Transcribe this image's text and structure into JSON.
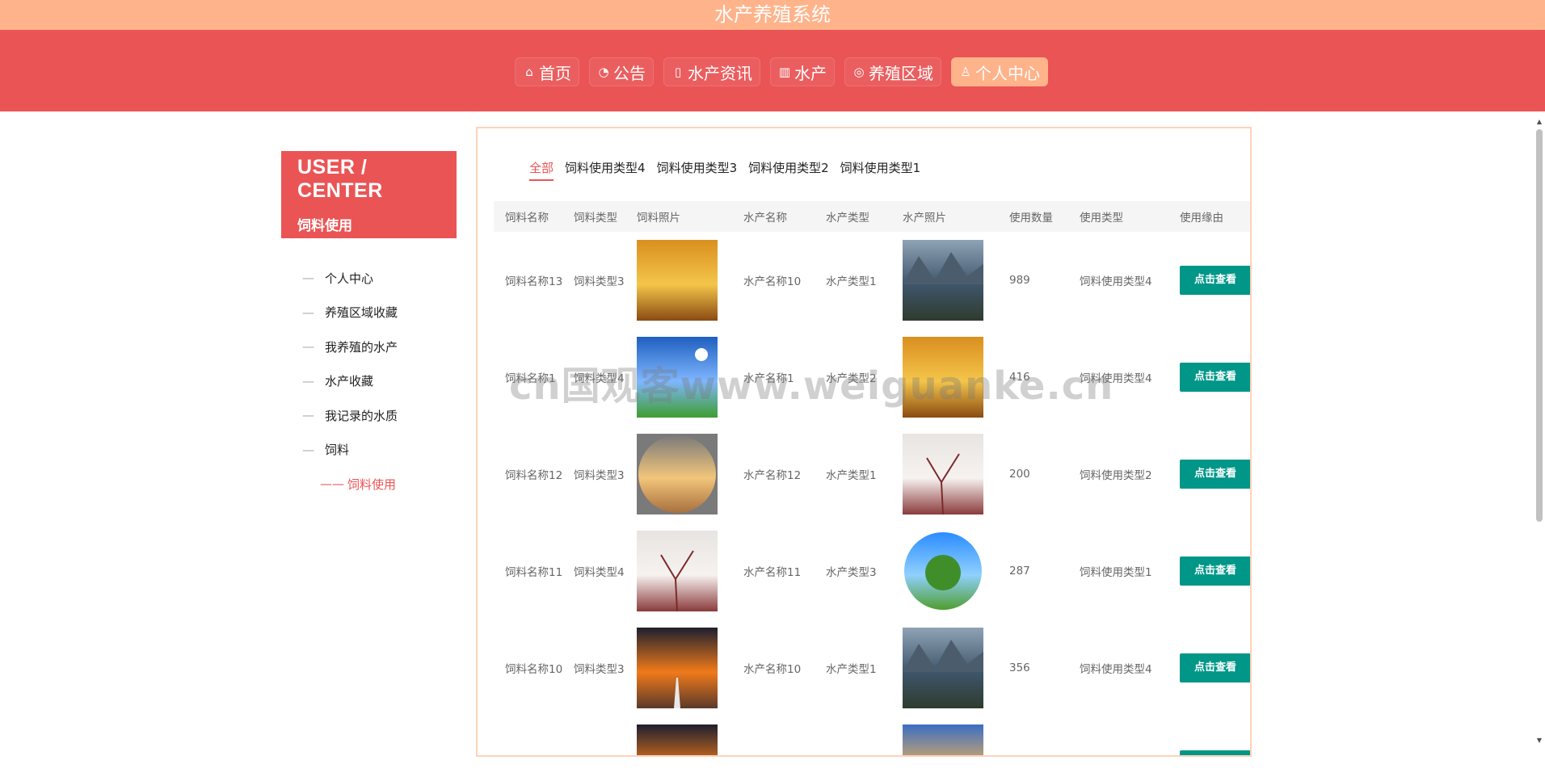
{
  "app": {
    "title": "水产养殖系统"
  },
  "nav": [
    {
      "label": "首页",
      "icon": "home-icon",
      "glyph": "⌂"
    },
    {
      "label": "公告",
      "icon": "gauge-icon",
      "glyph": "◔"
    },
    {
      "label": "水产资讯",
      "icon": "document-icon",
      "glyph": "▯"
    },
    {
      "label": "水产",
      "icon": "book-icon",
      "glyph": "▥"
    },
    {
      "label": "养殖区域",
      "icon": "palette-icon",
      "glyph": "◎"
    },
    {
      "label": "个人中心",
      "icon": "user-icon",
      "glyph": "♙",
      "active": true
    }
  ],
  "sidebar": {
    "heading": "USER / CENTER",
    "subheading": "饲料使用",
    "items": [
      {
        "label": "个人中心",
        "dash": "—"
      },
      {
        "label": "养殖区域收藏",
        "dash": "—"
      },
      {
        "label": "我养殖的水产",
        "dash": "—"
      },
      {
        "label": "水产收藏",
        "dash": "—"
      },
      {
        "label": "我记录的水质",
        "dash": "—"
      },
      {
        "label": "饲料",
        "dash": "—"
      }
    ],
    "sub_item": {
      "label": "饲料使用",
      "dash": "——"
    }
  },
  "tabs": [
    "全部",
    "饲料使用类型4",
    "饲料使用类型3",
    "饲料使用类型2",
    "饲料使用类型1"
  ],
  "table": {
    "headers": [
      "饲料名称",
      "饲料类型",
      "饲料照片",
      "水产名称",
      "水产类型",
      "水产照片",
      "使用数量",
      "使用类型",
      "使用缘由"
    ],
    "action_label": "点击查看",
    "rows": [
      {
        "feed_name": "饲料名称13",
        "feed_type": "饲料类型3",
        "feed_photo": "autumn",
        "aqua_name": "水产名称10",
        "aqua_type": "水产类型1",
        "aqua_photo": "lake",
        "qty": "989",
        "use_type": "饲料使用类型4"
      },
      {
        "feed_name": "饲料名称1",
        "feed_type": "饲料类型4",
        "feed_photo": "sky",
        "aqua_name": "水产名称1",
        "aqua_type": "水产类型2",
        "aqua_photo": "autumn",
        "qty": "416",
        "use_type": "饲料使用类型4"
      },
      {
        "feed_name": "饲料名称12",
        "feed_type": "饲料类型3",
        "feed_photo": "desert",
        "aqua_name": "水产名称12",
        "aqua_type": "水产类型1",
        "aqua_photo": "blossom",
        "qty": "200",
        "use_type": "饲料使用类型2"
      },
      {
        "feed_name": "饲料名称11",
        "feed_type": "饲料类型4",
        "feed_photo": "blossom",
        "aqua_name": "水产名称11",
        "aqua_type": "水产类型3",
        "aqua_photo": "planet",
        "qty": "287",
        "use_type": "饲料使用类型1"
      },
      {
        "feed_name": "饲料名称10",
        "feed_type": "饲料类型3",
        "feed_photo": "sunset",
        "aqua_name": "水产名称10",
        "aqua_type": "水产类型1",
        "aqua_photo": "lake",
        "qty": "356",
        "use_type": "饲料使用类型4"
      },
      {
        "feed_name": "",
        "feed_type": "",
        "feed_photo": "sunset",
        "aqua_name": "",
        "aqua_type": "",
        "aqua_photo": "desert-sky",
        "qty": "",
        "use_type": ""
      }
    ]
  },
  "watermark": "cn国观客www.weiguanke.cn",
  "scrollbar": {
    "up": "▲",
    "down": "▼"
  }
}
